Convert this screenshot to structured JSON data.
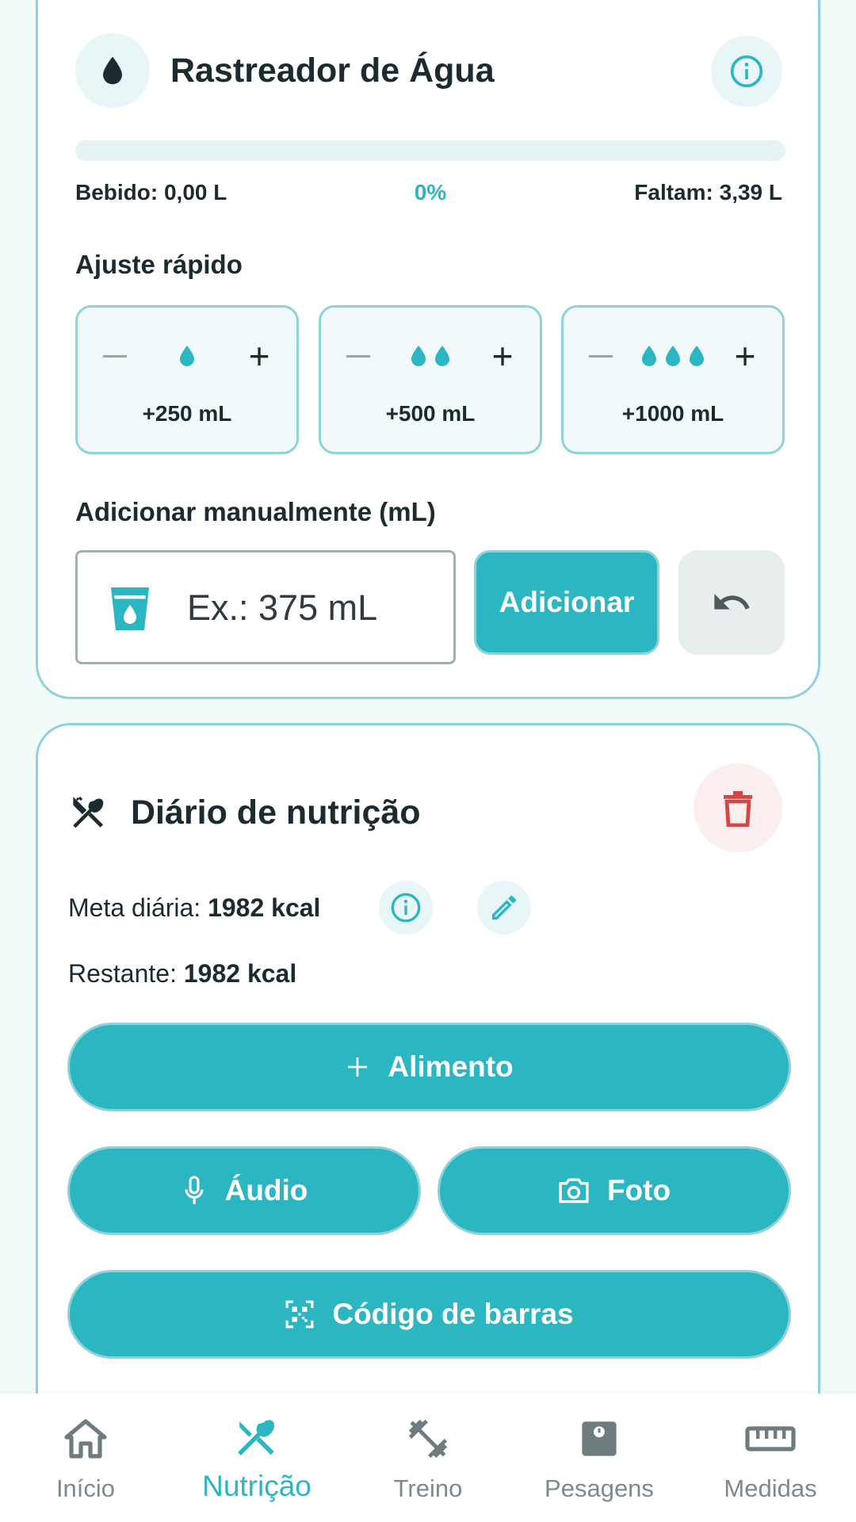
{
  "water_tracker": {
    "title": "Rastreador de Água",
    "progress_fraction": 0,
    "drunk": "Bebido: 0,00 L",
    "percent": "0%",
    "remaining": "Faltam: 3,39 L",
    "quick_adjust_label": "Ajuste rápido",
    "quick_options": [
      {
        "amount": "+250 mL",
        "drops": 1
      },
      {
        "amount": "+500 mL",
        "drops": 2
      },
      {
        "amount": "+1000 mL",
        "drops": 3
      }
    ],
    "manual_label": "Adicionar manualmente (mL)",
    "manual_placeholder": "Ex.: 375 mL",
    "add_button": "Adicionar"
  },
  "nutrition": {
    "title": "Diário de nutrição",
    "daily_goal_label": "Meta diária: ",
    "daily_goal_value": "1982 kcal",
    "remaining_label": "Restante: ",
    "remaining_value": "1982 kcal",
    "add_food": "Alimento",
    "audio": "Áudio",
    "photo": "Foto",
    "barcode": "Código de barras"
  },
  "nav": {
    "items": [
      {
        "label": "Início",
        "icon": "home-icon"
      },
      {
        "label": "Nutrição",
        "icon": "utensils-icon",
        "active": true
      },
      {
        "label": "Treino",
        "icon": "dumbbell-icon"
      },
      {
        "label": "Pesagens",
        "icon": "scale-icon"
      },
      {
        "label": "Medidas",
        "icon": "ruler-icon"
      }
    ]
  },
  "colors": {
    "accent": "#2bb6c1",
    "border": "#8fd3da",
    "danger": "#d64545",
    "inactive": "#7d8a8d"
  }
}
